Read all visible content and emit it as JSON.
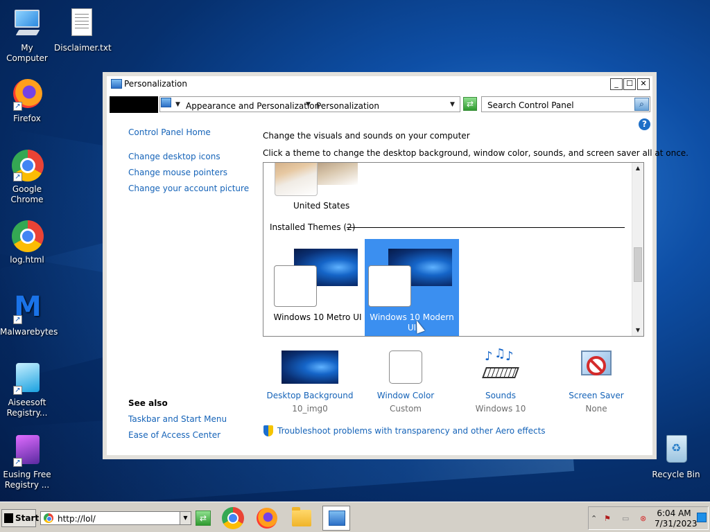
{
  "desktop": {
    "icons": [
      {
        "label": "My Computer"
      },
      {
        "label": "Disclaimer.txt"
      },
      {
        "label": "Firefox"
      },
      {
        "label": "Google Chrome"
      },
      {
        "label": "log.html"
      },
      {
        "label": "Malwarebytes"
      },
      {
        "label": "Aiseesoft Registry..."
      },
      {
        "label": "Eusing Free Registry ..."
      },
      {
        "label": "Recycle Bin"
      }
    ]
  },
  "window": {
    "title": "Personalization",
    "controls": {
      "minimize": "_",
      "maximize": "☐",
      "close": "✕"
    },
    "address": {
      "crumbs": [
        "Appearance and Personalization",
        "Personalization"
      ],
      "search_placeholder": "Search Control Panel"
    },
    "sidebar": {
      "home": "Control Panel Home",
      "links": [
        "Change desktop icons",
        "Change mouse pointers",
        "Change your account picture"
      ],
      "see_also_heading": "See also",
      "see_also": [
        "Taskbar and Start Menu",
        "Ease of Access Center"
      ]
    },
    "main": {
      "heading": "Change the visuals and sounds on your computer",
      "subheading": "Click a theme to change the desktop background, window color, sounds, and screen saver all at once.",
      "themes": {
        "partial_theme": "United States",
        "installed_group": "Installed Themes (2)",
        "installed": [
          {
            "name": "Windows 10 Metro UI",
            "selected": false
          },
          {
            "name": "Windows 10 Modern UI",
            "selected": true
          }
        ]
      },
      "tiles": [
        {
          "name": "Desktop Background",
          "value": "10_img0"
        },
        {
          "name": "Window Color",
          "value": "Custom"
        },
        {
          "name": "Sounds",
          "value": "Windows 10"
        },
        {
          "name": "Screen Saver",
          "value": "None"
        }
      ],
      "troubleshoot": "Troubleshoot problems with transparency and other Aero effects"
    }
  },
  "taskbar": {
    "start": "Start",
    "url": "http://lol/",
    "clock_time": "6:04 AM",
    "clock_date": "7/31/2023"
  }
}
